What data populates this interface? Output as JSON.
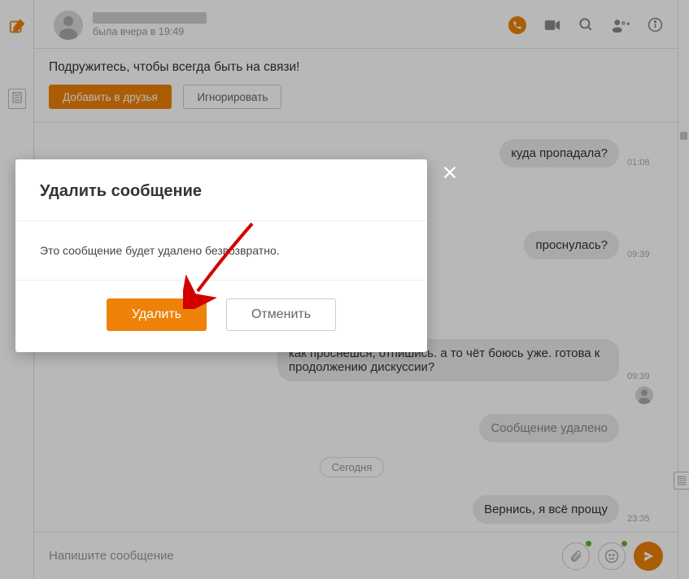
{
  "header": {
    "status": "была вчера в 19:49"
  },
  "friend_prompt": {
    "text": "Подружитесь, чтобы всегда быть на связи!",
    "add_label": "Добавить в друзья",
    "ignore_label": "Игнорировать"
  },
  "chat": {
    "date_label": "Сегодня",
    "messages": [
      {
        "text": "куда пропадала?",
        "time": "01:08"
      },
      {
        "text": "проснулась?",
        "time": "09:39"
      },
      {
        "text": "как проснёшся, отпишись. а то чёт боюсь уже. готова к продолжению дискуссии?",
        "time": "09:39"
      },
      {
        "text": "Сообщение удалено",
        "time": ""
      },
      {
        "text": "Вернись, я всё прощу",
        "time": "23:35"
      }
    ]
  },
  "composer": {
    "placeholder": "Напишите сообщение"
  },
  "modal": {
    "title": "Удалить сообщение",
    "body": "Это сообщение будет удалено безвозвратно.",
    "delete_label": "Удалить",
    "cancel_label": "Отменить"
  }
}
